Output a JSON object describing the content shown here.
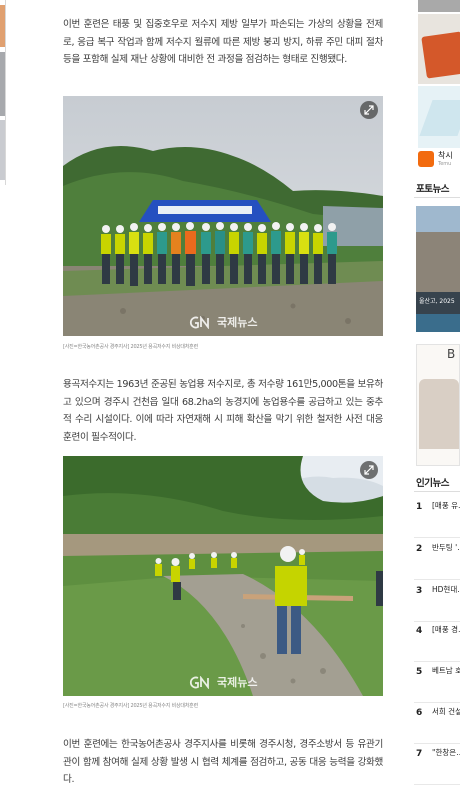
{
  "article": {
    "paragraphs": [
      "이번 훈련은 태풍 및 집중호우로 저수지 제방 일부가 파손되는 가상의 상황을 전제로, 응급 복구 작업과 함께 저수지 월류에 따른 제방 붕괴 방지, 하류 주민 대피 절차 등을 포함해 실제 재난 상황에 대비한 전 과정을 점검하는 형태로 진행됐다.",
      "용곡저수지는 1963년 준공된 농업용 저수지로, 총 저수량 161만5,000톤을 보유하고 있으며 경주시 건천읍 일대 68.2ha의 농경지에 농업용수를 공급하고 있는 중추적 수리 시설이다. 이에 따라 자연재해 시 피해 확산을 막기 위한 철저한 사전 대응 훈련이 필수적이다.",
      "이번 훈련에는 한국농어촌공사 경주지사를 비롯해 경주시청, 경주소방서 등 유관기관이 함께 참여해 실제 상황 발생 시 협력 체계를 점검하고, 공동 대응 능력을 강화했다."
    ],
    "photos": [
      {
        "watermark": "국제뉴스",
        "caption": "[사진=한국농어촌공사 경주지사] 2025년 용곡저수지 비상대처훈련"
      },
      {
        "watermark": "국제뉴스",
        "caption": "[사진=한국농어촌공사 경주지사] 2025년 용곡저수지 비상대처훈련"
      }
    ]
  },
  "sidebar": {
    "ad_label": "착시",
    "ad_sub": "Temu",
    "photo_news_title": "포토뉴스",
    "photo_caption": "울산고, 2025",
    "banner_letter": "B",
    "popular_title": "인기뉴스",
    "popular": [
      {
        "rank": "1",
        "title": "[매풍 유…갑머기 !"
      },
      {
        "rank": "2",
        "title": "반두팅 '…정치 게임"
      },
      {
        "rank": "3",
        "title": "HD현대…Ⅱ정능역"
      },
      {
        "rank": "4",
        "title": "[매풍 경…풍 갑비"
      },
      {
        "rank": "5",
        "title": "베트남 호…우소 임"
      },
      {
        "rank": "6",
        "title": "서희 건설…일감 몰아"
      },
      {
        "rank": "7",
        "title": "\"한창은…자\"…농"
      }
    ]
  },
  "colors": {
    "accent": "#333333",
    "temu": "#f26b0f"
  }
}
